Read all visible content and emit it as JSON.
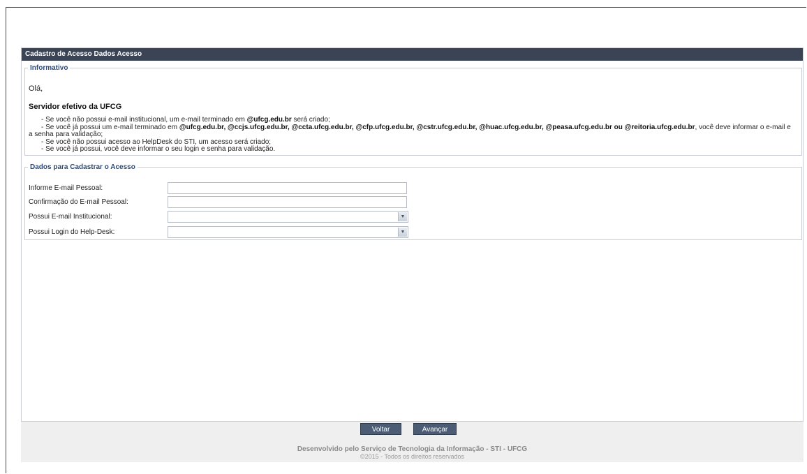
{
  "panel": {
    "title": "Cadastro de Acesso Dados Acesso"
  },
  "informativo": {
    "legend": "Informativo",
    "greeting": "Olá,",
    "subtitle": "Servidor efetivo da UFCG",
    "bullet1_pre": "- Se você não possui e-mail institucional, um e-mail terminado em ",
    "bullet1_bold": "@ufcg.edu.br",
    "bullet1_post": " será criado;",
    "bullet2_pre": "- Se você já possui um e-mail terminado em ",
    "bullet2_bold": "@ufcg.edu.br, @ccjs.ufcg.edu.br, @ccta.ufcg.edu.br, @cfp.ufcg.edu.br, @cstr.ufcg.edu.br, @huac.ufcg.edu.br, @peasa.ufcg.edu.br ou @reitoria.ufcg.edu.br",
    "bullet2_post": ", você deve informar o e-mail e a senha para validação;",
    "bullet3": "- Se você não possui acesso ao HelpDesk do STI, um acesso será criado;",
    "bullet4": "- Se você já possui, você deve informar o seu login e senha para validação."
  },
  "dados": {
    "legend": "Dados para Cadastrar o Acesso",
    "email_label": "Informe E-mail Pessoal:",
    "email_value": "",
    "email_confirm_label": "Confirmação do E-mail Pessoal:",
    "email_confirm_value": "",
    "institucional_label": "Possui E-mail Institucional:",
    "institucional_value": "",
    "helpdesk_label": "Possui Login do Help-Desk:",
    "helpdesk_value": ""
  },
  "footer": {
    "voltar_label": "Voltar",
    "avancar_label": "Avançar",
    "credit": "Desenvolvido pelo Serviço de Tecnologia da Informação - STI - UFCG",
    "copyright": "©2015 - Todos os direitos reservados"
  },
  "colors": {
    "header_bg": "#3b4454",
    "legend_text": "#2b4a7a",
    "button_bg": "#4b5c74",
    "footer_bg": "#efefef"
  }
}
